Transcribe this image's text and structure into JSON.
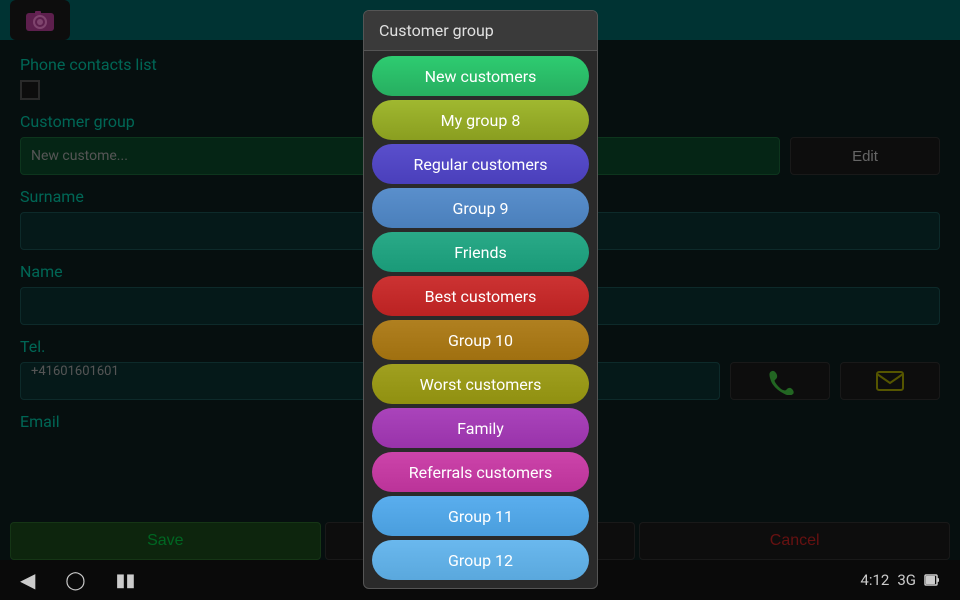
{
  "topBar": {
    "color": "#006666"
  },
  "form": {
    "phoneContactsLabel": "Phone contacts list",
    "customerGroupLabel": "Customer group",
    "customerGroupValue": "New custome...",
    "editButtonLabel": "Edit",
    "surnameLabel": "Surname",
    "nameLabel": "Name",
    "telLabel": "Tel.",
    "telValue": "+41601601601",
    "emailLabel": "Email"
  },
  "buttons": {
    "saveLabel": "Save",
    "cancelLabel": "Cancel"
  },
  "dropdown": {
    "title": "Customer group",
    "items": [
      {
        "id": "new-customers",
        "label": "New customers",
        "cssClass": "item-new-customers"
      },
      {
        "id": "my-group-8",
        "label": "My group 8",
        "cssClass": "item-my-group-8"
      },
      {
        "id": "regular-customers",
        "label": "Regular customers",
        "cssClass": "item-regular-customers"
      },
      {
        "id": "group-9",
        "label": "Group 9",
        "cssClass": "item-group-9"
      },
      {
        "id": "friends",
        "label": "Friends",
        "cssClass": "item-friends"
      },
      {
        "id": "best-customers",
        "label": "Best customers",
        "cssClass": "item-best-customers"
      },
      {
        "id": "group-10",
        "label": "Group 10",
        "cssClass": "item-group-10"
      },
      {
        "id": "worst-customers",
        "label": "Worst customers",
        "cssClass": "item-worst-customers"
      },
      {
        "id": "family",
        "label": "Family",
        "cssClass": "item-family"
      },
      {
        "id": "referrals-customers",
        "label": "Referrals customers",
        "cssClass": "item-referrals"
      },
      {
        "id": "group-11",
        "label": "Group 11",
        "cssClass": "item-group-11"
      },
      {
        "id": "group-12",
        "label": "Group 12",
        "cssClass": "item-group-12"
      }
    ]
  },
  "statusBar": {
    "time": "4:12",
    "signal": "3G"
  }
}
